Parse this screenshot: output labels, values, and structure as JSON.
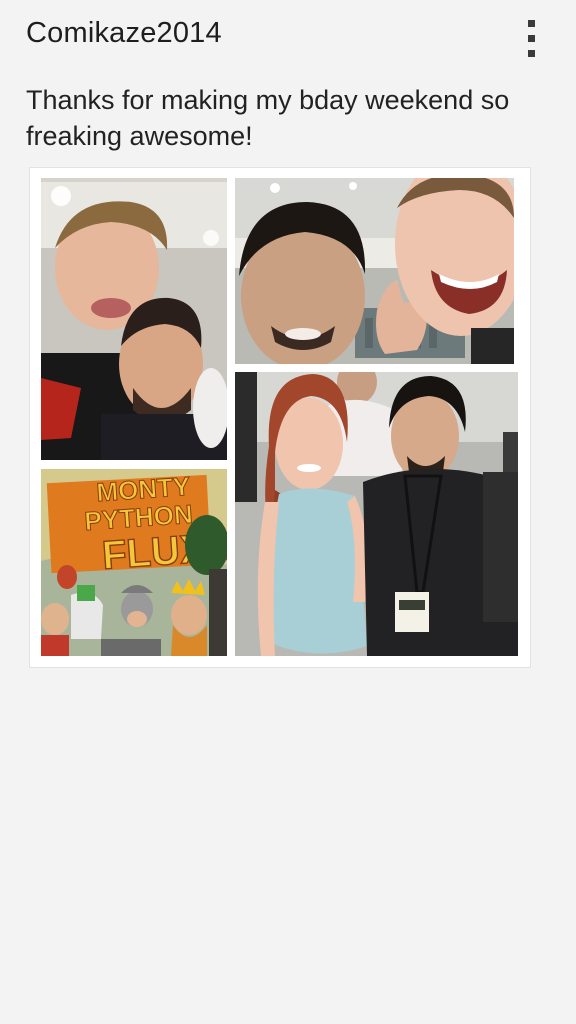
{
  "post": {
    "author": "Comikaze2014",
    "caption": "Thanks for making my bday weekend so freaking awesome!"
  },
  "header": {
    "menu_icon": "overflow-menu-icon"
  },
  "collage": {
    "photos": [
      {
        "name": "selfie-two-men"
      },
      {
        "name": "selfie-thumbs-up"
      },
      {
        "name": "monty-python-fluxx-box",
        "text": "MONTY PYTHON FLUXX"
      },
      {
        "name": "photo-woman-and-man-at-convention"
      }
    ]
  },
  "colors": {
    "background": "#f3f3f3",
    "card": "#ffffff",
    "text": "#1e1e1e",
    "box_orange": "#e07a1e",
    "box_yellow": "#f2c83a"
  }
}
